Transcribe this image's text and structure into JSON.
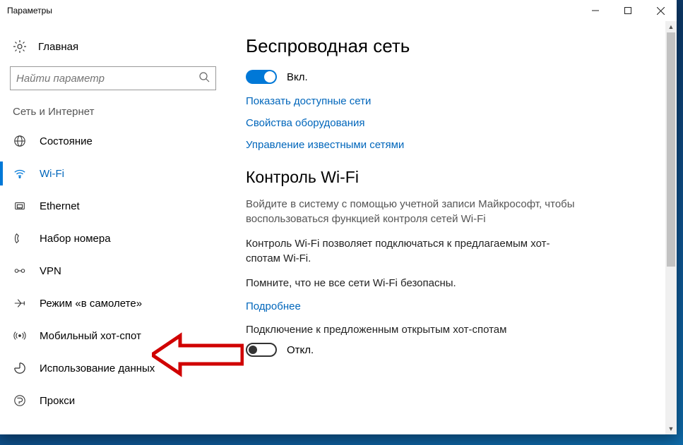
{
  "window": {
    "title": "Параметры"
  },
  "sidebar": {
    "home": "Главная",
    "search_placeholder": "Найти параметр",
    "section": "Сеть и Интернет",
    "items": [
      {
        "label": "Состояние",
        "icon": "globe"
      },
      {
        "label": "Wi-Fi",
        "icon": "wifi",
        "active": true
      },
      {
        "label": "Ethernet",
        "icon": "ethernet"
      },
      {
        "label": "Набор номера",
        "icon": "dialup"
      },
      {
        "label": "VPN",
        "icon": "vpn"
      },
      {
        "label": "Режим «в самолете»",
        "icon": "airplane"
      },
      {
        "label": "Мобильный хот-спот",
        "icon": "hotspot"
      },
      {
        "label": "Использование данных",
        "icon": "datausage"
      },
      {
        "label": "Прокси",
        "icon": "proxy"
      }
    ]
  },
  "main": {
    "h1": "Беспроводная сеть",
    "toggle1_label": "Вкл.",
    "link1": "Показать доступные сети",
    "link2": "Свойства оборудования",
    "link3": "Управление известными сетями",
    "h2": "Контроль Wi-Fi",
    "p1": "Войдите в систему с помощью учетной записи Майкрософт, чтобы воспользоваться функцией контроля сетей Wi-Fi",
    "p2": "Контроль Wi-Fi позволяет подключаться к предлагаемым хот-спотам Wi-Fi.",
    "p3": "Помните, что не все сети Wi-Fi безопасны.",
    "link4": "Подробнее",
    "p4": "Подключение к предложенным открытым хот-спотам",
    "toggle2_label": "Откл."
  }
}
